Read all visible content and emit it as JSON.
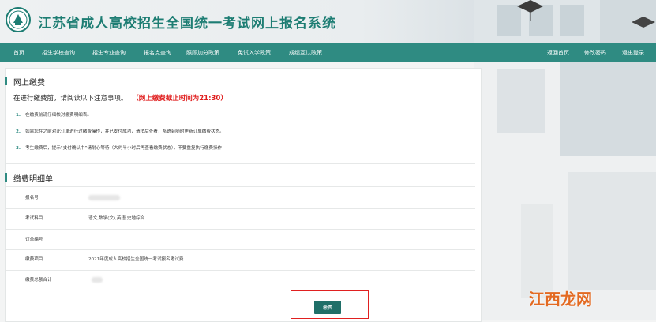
{
  "header": {
    "title": "江苏省成人高校招生全国统一考试网上报名系统",
    "logo_icon": "school-emblem-icon"
  },
  "nav": {
    "items": [
      "首页",
      "招生学校查询",
      "招生专业查询",
      "报名点查询",
      "照顾加分政策",
      "免试入学政策",
      "成绩互认政策"
    ],
    "right_items": [
      "返回首页",
      "修改密码",
      "退出登录"
    ]
  },
  "payment": {
    "section_title": "网上缴费",
    "intro": "在进行缴费前，请阅读以下注意事项。",
    "deadline": "（网上缴费截止时间为21:30）",
    "notices": [
      {
        "num": "1.",
        "text": "在缴费前请仔细核对缴费明细表。"
      },
      {
        "num": "2.",
        "text": "如果您在之前对此订单进行过缴费操作，并已支付成功，请稍后查看，系统会随时更新订单缴费状态。"
      },
      {
        "num": "3.",
        "text": "考生缴费后，提示“支付确认中”请耐心等待（大约半小时后再查看缴费状态），不要重复执行缴费操作！"
      }
    ]
  },
  "detail": {
    "section_title": "缴费明细单",
    "rows": [
      {
        "label": "报名号",
        "value": ""
      },
      {
        "label": "考试科目",
        "value": "语文,数学(文),英语,史地综合"
      },
      {
        "label": "订单编号",
        "value": ""
      },
      {
        "label": "缴费项目",
        "value": "2021年度成人高校招生全国统一考试报名考试费"
      },
      {
        "label": "缴费总额合计",
        "value": ""
      }
    ],
    "pay_button": "缴费"
  },
  "watermark": {
    "text": "江西龙网",
    "color": "#e36a22"
  },
  "colors": {
    "brand": "#2f8b82",
    "deadline": "#e01e1e",
    "highlight": "#e02020"
  }
}
